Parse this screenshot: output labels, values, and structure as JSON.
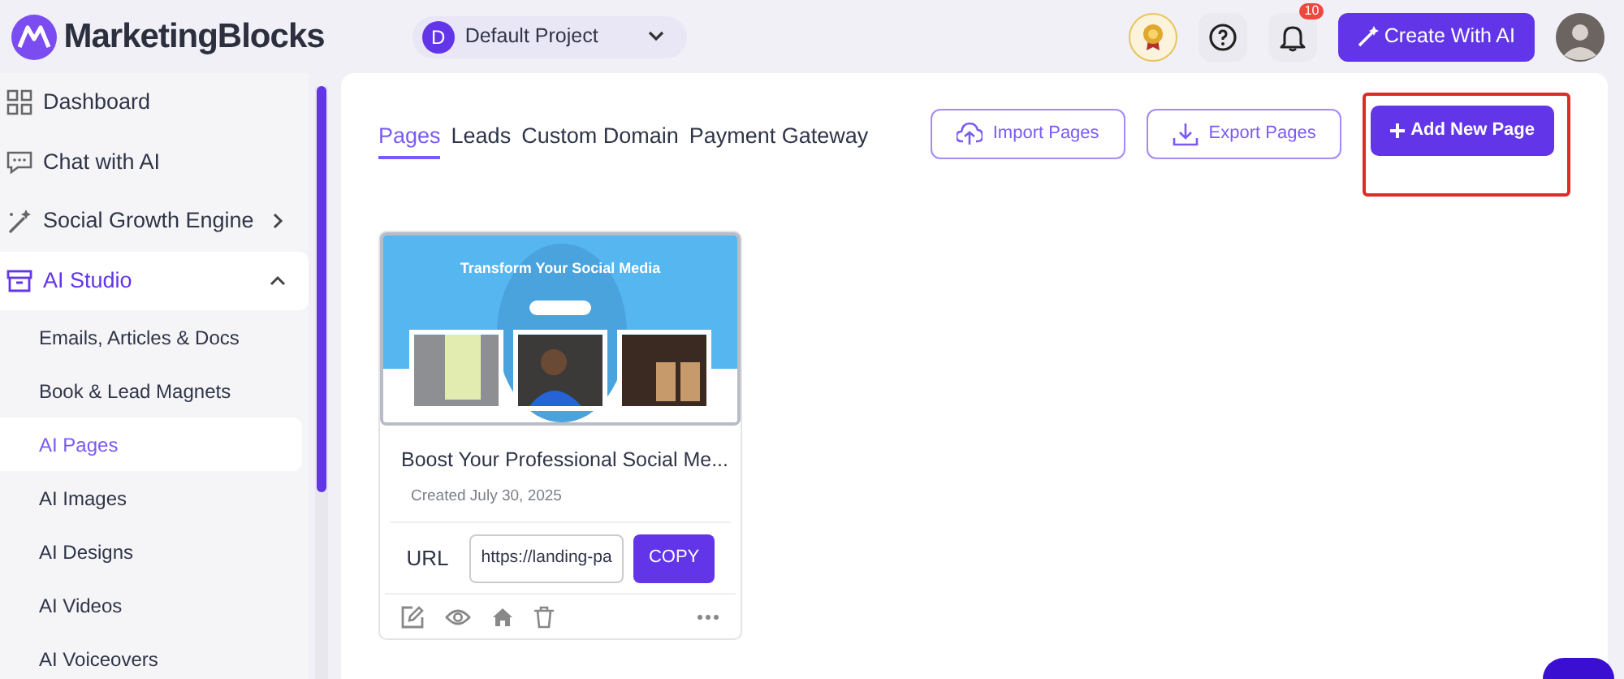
{
  "header": {
    "logo": "MarketingBlocks",
    "project": {
      "initial": "D",
      "name": "Default Project"
    },
    "notification_count": "10",
    "create_button": "Create With AI"
  },
  "sidebar": {
    "items": [
      {
        "label": "Dashboard",
        "selected": false
      },
      {
        "label": "Chat with AI",
        "selected": false
      },
      {
        "label": "Social Growth Engine",
        "selected": false,
        "expanded": false
      },
      {
        "label": "AI Studio",
        "selected": true,
        "expanded": true,
        "children": [
          {
            "label": "Emails, Articles & Docs",
            "selected": false
          },
          {
            "label": "Book & Lead Magnets",
            "selected": false
          },
          {
            "label": "AI Pages",
            "selected": true
          },
          {
            "label": "AI Images",
            "selected": false
          },
          {
            "label": "AI Designs",
            "selected": false
          },
          {
            "label": "AI Videos",
            "selected": false
          },
          {
            "label": "AI Voiceovers",
            "selected": false
          }
        ]
      }
    ]
  },
  "tabs": [
    {
      "label": "Pages",
      "selected": true
    },
    {
      "label": "Leads",
      "selected": false
    },
    {
      "label": "Custom Domain",
      "selected": false
    },
    {
      "label": "Payment Gateway",
      "selected": false
    }
  ],
  "actions": [
    {
      "label": "Import Pages",
      "kind": "outline",
      "highlighted": false
    },
    {
      "label": "Export Pages",
      "kind": "outline",
      "highlighted": false
    },
    {
      "label": "Add New Page",
      "kind": "primary",
      "highlighted": true
    }
  ],
  "pages": [
    {
      "thumbnail_headline": "Transform Your Social Media",
      "title": "Boost Your Professional Social Me...",
      "created": "Created July 30, 2025",
      "url_label": "URL",
      "url": "https://landing-pa",
      "copy_button": "COPY"
    }
  ]
}
